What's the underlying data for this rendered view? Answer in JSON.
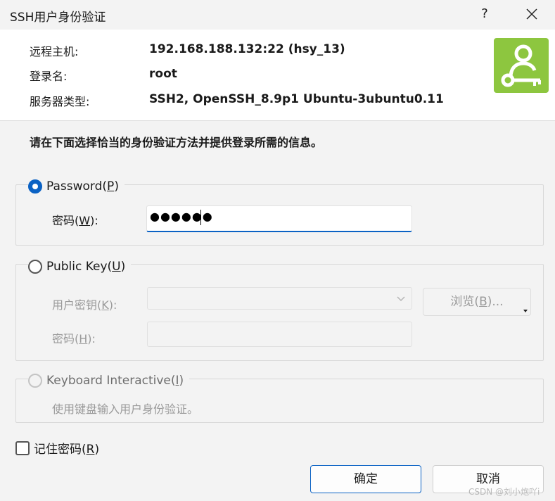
{
  "window": {
    "title": "SSH用户身份验证",
    "help_label": "?",
    "close_icon": "close-icon"
  },
  "host_info": {
    "remote_host_label": "远程主机:",
    "remote_host_value": "192.168.188.132:22 (hsy_13)",
    "login_name_label": "登录名:",
    "login_name_value": "root",
    "server_type_label": "服务器类型:",
    "server_type_value": "SSH2, OpenSSH_8.9p1 Ubuntu-3ubuntu0.11",
    "logo_icon": "user-key-icon",
    "logo_color": "#8dc63f"
  },
  "instruction": "请在下面选择恰当的身份验证方法并提供登录所需的信息。",
  "password_section": {
    "option_prefix": "Password(",
    "option_key": "P",
    "option_suffix": ")",
    "selected": true,
    "password_label_prefix": "密码(",
    "password_label_key": "W",
    "password_label_suffix": "):",
    "password_value": "●●●●●●"
  },
  "public_key_section": {
    "option_prefix": "Public Key(",
    "option_key": "U",
    "option_suffix": ")",
    "selected": false,
    "user_key_label_prefix": "用户密钥(",
    "user_key_label_key": "K",
    "user_key_label_suffix": "):",
    "user_key_value": "",
    "browse_prefix": "浏览(",
    "browse_key": "B",
    "browse_suffix": ")...",
    "passphrase_label_prefix": "密码(",
    "passphrase_label_key": "H",
    "passphrase_label_suffix": "):",
    "passphrase_value": ""
  },
  "keyboard_interactive_section": {
    "option_prefix": "Keyboard Interactive(",
    "option_key": "I",
    "option_suffix": ")",
    "description": "使用键盘输入用户身份验证。"
  },
  "remember": {
    "label_prefix": "记住密码(",
    "label_key": "R",
    "label_suffix": ")",
    "checked": false
  },
  "buttons": {
    "ok": "确定",
    "cancel": "取消"
  },
  "watermark": "CSDN @刘小炮吖i",
  "colors": {
    "accent": "#0b62c4",
    "disabled_text": "#9a9a9a"
  }
}
